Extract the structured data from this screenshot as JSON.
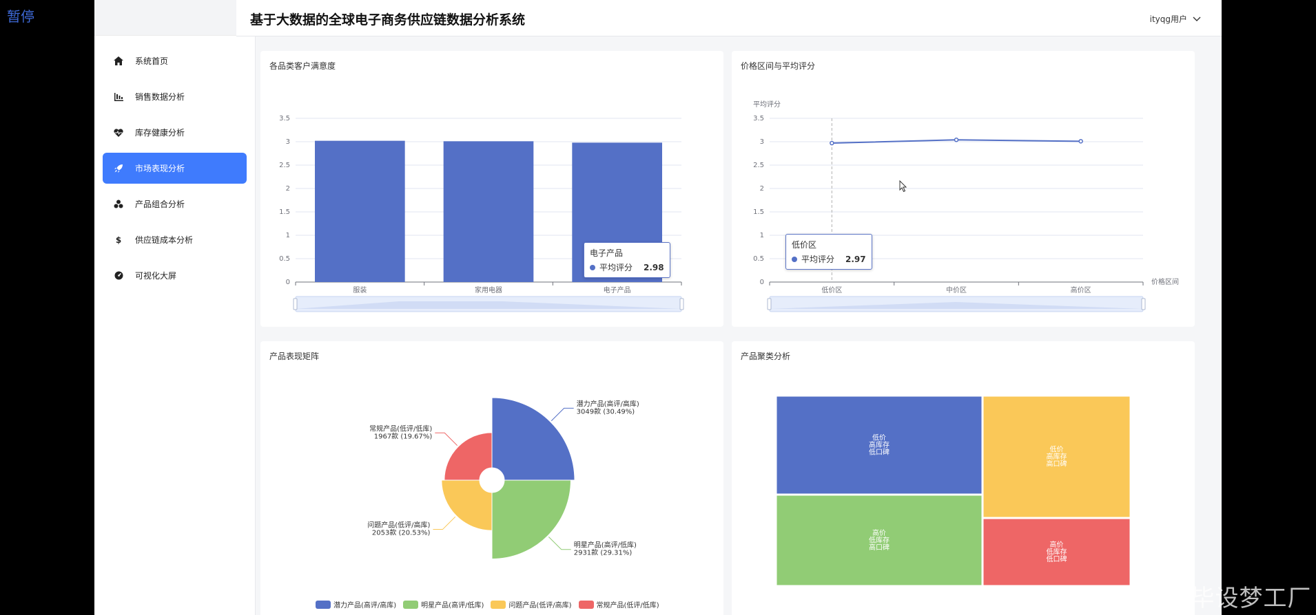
{
  "overlay": {
    "pause_label": "暂停",
    "watermark": "CSDN @IT毕设梦工厂"
  },
  "header": {
    "title": "基于大数据的全球电子商务供应链数据分析系统",
    "user": "ityqg用户"
  },
  "sidebar": {
    "items": [
      {
        "label": "系统首页",
        "icon": "home-icon",
        "active": false
      },
      {
        "label": "销售数据分析",
        "icon": "bar-chart-icon",
        "active": false
      },
      {
        "label": "库存健康分析",
        "icon": "heart-pulse-icon",
        "active": false
      },
      {
        "label": "市场表现分析",
        "icon": "rocket-icon",
        "active": true
      },
      {
        "label": "产品组合分析",
        "icon": "cubes-icon",
        "active": false
      },
      {
        "label": "供应链成本分析",
        "icon": "dollar-icon",
        "active": false
      },
      {
        "label": "可视化大屏",
        "icon": "dashboard-icon",
        "active": false
      }
    ]
  },
  "cards": {
    "satisfaction": {
      "title": "各品类客户满意度",
      "tooltip": {
        "category": "电子产品",
        "series": "平均评分",
        "value": "2.98"
      }
    },
    "price": {
      "title": "价格区间与平均评分",
      "tooltip": {
        "category": "低价区",
        "series": "平均评分",
        "value": "2.97"
      }
    },
    "matrix": {
      "title": "产品表现矩阵"
    },
    "cluster": {
      "title": "产品聚类分析"
    }
  },
  "chart_data": [
    {
      "type": "bar",
      "title": "各品类客户满意度",
      "categories": [
        "服装",
        "家用电器",
        "电子产品"
      ],
      "series": [
        {
          "name": "平均评分",
          "values": [
            3.02,
            3.01,
            2.98
          ]
        }
      ],
      "ylim": [
        0,
        3.5
      ],
      "yticks": [
        "0",
        "0.5",
        "1",
        "1.5",
        "2",
        "2.5",
        "3",
        "3.5"
      ],
      "color": "#5470c6",
      "grid": true
    },
    {
      "type": "line",
      "title": "价格区间与平均评分",
      "ylabel": "平均评分",
      "xlabel": "价格区间",
      "categories": [
        "低价区",
        "中价区",
        "高价区"
      ],
      "series": [
        {
          "name": "平均评分",
          "values": [
            2.97,
            3.04,
            3.01
          ]
        }
      ],
      "ylim": [
        0,
        3.5
      ],
      "yticks": [
        "0",
        "0.5",
        "1",
        "1.5",
        "2",
        "2.5",
        "3",
        "3.5"
      ],
      "color": "#5470c6",
      "grid": true
    },
    {
      "type": "pie",
      "title": "产品表现矩阵",
      "rose": true,
      "slices": [
        {
          "name": "潜力产品(高评/高库)",
          "value": 3049,
          "label": "3049款 (30.49%)",
          "color": "#5470c6"
        },
        {
          "name": "明星产品(高评/低库)",
          "value": 2931,
          "label": "2931款 (29.31%)",
          "color": "#91cc75"
        },
        {
          "name": "问题产品(低评/高库)",
          "value": 2053,
          "label": "2053款 (20.53%)",
          "color": "#fac858"
        },
        {
          "name": "常规产品(低评/低库)",
          "value": 1967,
          "label": "1967款 (19.67%)",
          "color": "#ee6666"
        }
      ],
      "legend": "bottom"
    },
    {
      "type": "treemap",
      "title": "产品聚类分析",
      "nodes": [
        {
          "label": [
            "低价",
            "高库存",
            "低口碑"
          ],
          "color": "#5470c6"
        },
        {
          "label": [
            "低价",
            "高库存",
            "高口碑"
          ],
          "color": "#fac858"
        },
        {
          "label": [
            "高价",
            "低库存",
            "高口碑"
          ],
          "color": "#91cc75"
        },
        {
          "label": [
            "高价",
            "低库存",
            "低口碑"
          ],
          "color": "#ee6666"
        }
      ]
    }
  ]
}
